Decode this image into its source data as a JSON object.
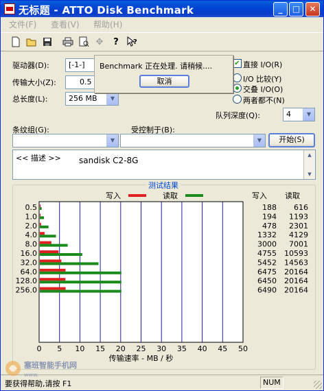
{
  "window": {
    "title": "无标题 - ATTO Disk Benchmark",
    "controls": {
      "minimize": "_",
      "maximize": "□",
      "close": "✕"
    }
  },
  "menu": [
    {
      "label": "文件(F)"
    },
    {
      "label": "查看(V)"
    },
    {
      "label": "帮助(H)"
    }
  ],
  "toolbar": {
    "icons": [
      "new-icon",
      "open-icon",
      "save-icon",
      "print-icon",
      "print-preview-icon",
      "move-icon",
      "help-icon",
      "context-help-icon"
    ]
  },
  "form": {
    "drive_label": "驱动器(D):",
    "drive_value": "[-1-]",
    "transfer_size_label": "传输大小(Z):",
    "transfer_size_value": "0.5",
    "total_length_label": "总长度(L):",
    "total_length_value": "256 MB",
    "direct_io_label": "直接 I/O(R)",
    "direct_io_checked": true,
    "io_compare_label": "I/O 比较(Y)",
    "overlapped_io_label": "交叠 I/O(O)",
    "neither_label": "两者都不(N)",
    "selected_io_mode": "overlapped",
    "queue_depth_label": "队列深度(Q):",
    "queue_depth_value": "4",
    "stripe_group_label": "条纹组(G):",
    "stripe_group_value": "",
    "controlled_by_label": "受控制于(B):",
    "controlled_by_value": "",
    "start_button": "开始(S)",
    "description_label": "<< 描述 >>",
    "description_value": "sandisk C2-8G"
  },
  "popup": {
    "message": "Benchmark 正在处理. 请稍候....",
    "cancel_button": "取消"
  },
  "results": {
    "group_title": "测试结果",
    "legend_write": "写入",
    "legend_read": "读取",
    "col_write": "写入",
    "col_read": "读取",
    "colors": {
      "write": "#e02020",
      "read": "#1a8a1a",
      "grid": "#1c1ca8"
    }
  },
  "chart_data": {
    "type": "bar",
    "orientation": "horizontal",
    "categories": [
      "0.5",
      "1.0",
      "2.0",
      "4.0",
      "8.0",
      "16.0",
      "32.0",
      "64.0",
      "128.0",
      "256.0"
    ],
    "series": [
      {
        "name": "写入",
        "values": [
          188,
          194,
          478,
          1332,
          3000,
          4755,
          5452,
          6475,
          6450,
          6490
        ]
      },
      {
        "name": "读取",
        "values": [
          616,
          1193,
          2301,
          4129,
          7001,
          10593,
          14563,
          20164,
          20164,
          20164
        ]
      }
    ],
    "xlabel": "传输速率 - MB / 秒",
    "xlim": [
      0,
      50
    ],
    "xticks": [
      "0",
      "5",
      "10",
      "15",
      "20",
      "25",
      "30",
      "35",
      "40",
      "45",
      "50"
    ]
  },
  "statusbar": {
    "help_text": "要获得帮助,请按 F1",
    "num_indicator": "NUM"
  },
  "watermark": {
    "text": "塞班智能手机网"
  }
}
